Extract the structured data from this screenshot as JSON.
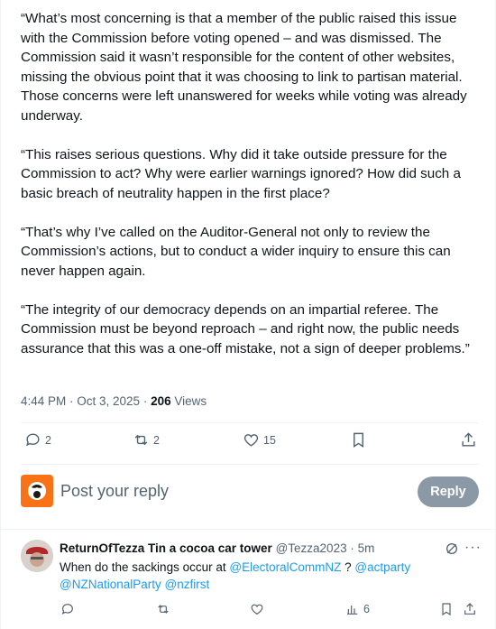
{
  "post": {
    "paragraphs": [
      "“What’s most concerning is that a member of the public raised this issue with the Commission before voting opened – and was dismissed. The Commission said it wasn’t responsible for the content of other websites, missing the obvious point that it was choosing to link to partisan material. Those concerns were left unanswered for weeks while voting was already underway.",
      "“This raises serious questions. Why did it take outside pressure for the Commission to act? Why were earlier warnings ignored? How did such a basic breach of neutrality happen in the first place?",
      "“That’s why I’ve called on the Auditor-General not only to review the Commission’s actions, but to conduct a wider inquiry to ensure this can never happen again.",
      "“The integrity of our democracy depends on an impartial referee. The Commission must be beyond reproach – and right now, the public needs assurance that this was a one-off mistake, not a sign of deeper problems.”"
    ],
    "timestamp": "4:44 PM · Oct 3, 2025 ·",
    "views_count": "206",
    "views_label": "Views",
    "replies": "2",
    "reposts": "2",
    "likes": "15"
  },
  "composer": {
    "placeholder": "Post your reply",
    "reply_label": "Reply"
  },
  "reply": {
    "name": "ReturnOfTezza Tin a cocoa car tower",
    "handle": "@Tezza2023",
    "dot": "·",
    "time": "5m",
    "text_1": "When do the sackings occur at ",
    "mention_1": "@ElectoralCommNZ",
    "text_2": " ? ",
    "mention_2": "@actparty",
    "mention_3": "@NZNationalParty",
    "text_3": " ",
    "mention_4": "@nzfirst",
    "views": "6"
  },
  "colors": {
    "text": "#0f1419",
    "secondary": "#536471",
    "link": "#1d9bf0",
    "reply_button": "#8b98a5",
    "avatar_me": "#f97316"
  }
}
